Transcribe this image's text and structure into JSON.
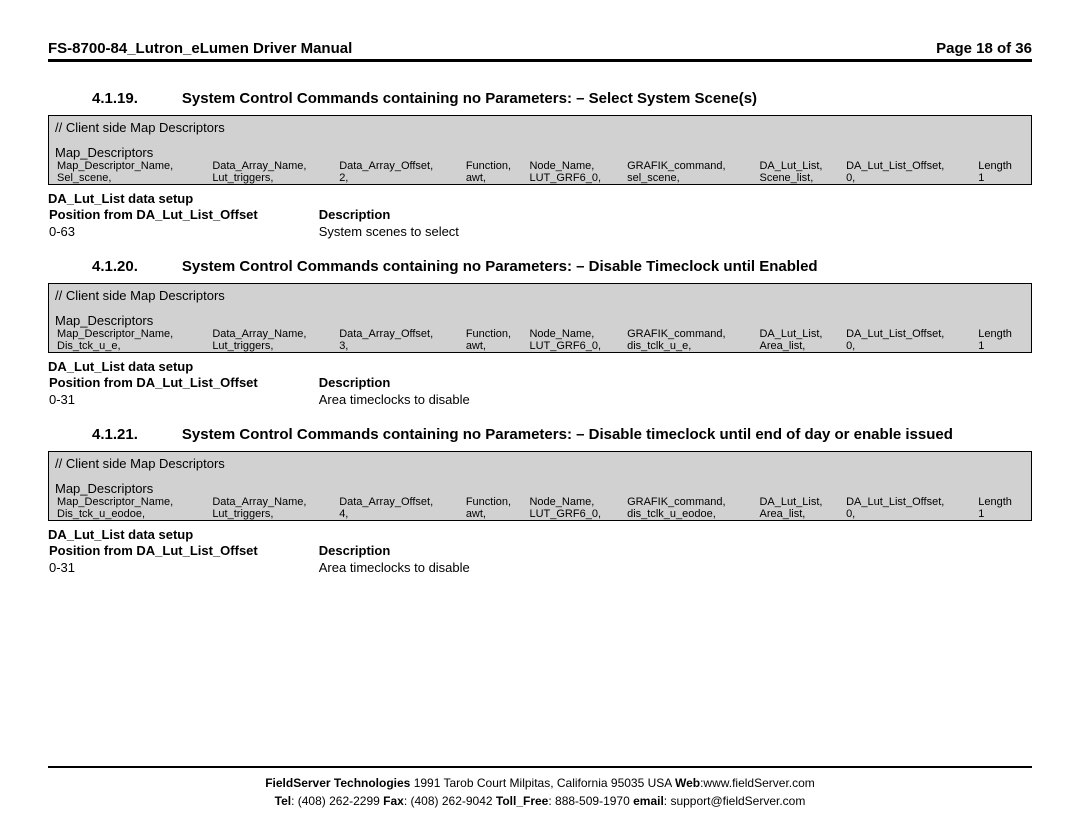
{
  "header": {
    "title": "FS-8700-84_Lutron_eLumen Driver Manual",
    "page": "Page 18 of 36"
  },
  "csv_columns": [
    "Map_Descriptor_Name,",
    "Data_Array_Name,",
    "Data_Array_Offset,",
    "Function,",
    "Node_Name,",
    "GRAFIK_command,",
    "DA_Lut_List,",
    "DA_Lut_List_Offset,",
    "Length"
  ],
  "common": {
    "comment": "//    Client side Map Descriptors",
    "mapdesc": "Map_Descriptors",
    "setup_head": "DA_Lut_List data setup",
    "pos_head": "Position from DA_Lut_List_Offset",
    "desc_head": "Description"
  },
  "sections": [
    {
      "num": "4.1.19.",
      "title": "System Control Commands containing no Parameters: – Select System Scene(s)",
      "row": [
        "Sel_scene,",
        "Lut_triggers,",
        "2,",
        "awt,",
        "LUT_GRF6_0,",
        "sel_scene,",
        "Scene_list,",
        "0,",
        "1"
      ],
      "pos": "0-63",
      "desc": "System scenes to select"
    },
    {
      "num": "4.1.20.",
      "title": "System Control Commands containing no Parameters: – Disable Timeclock until Enabled",
      "row": [
        "Dis_tck_u_e,",
        "Lut_triggers,",
        "3,",
        "awt,",
        "LUT_GRF6_0,",
        "dis_tclk_u_e,",
        "Area_list,",
        "0,",
        "1"
      ],
      "pos": "0-31",
      "desc": "Area timeclocks to disable"
    },
    {
      "num": "4.1.21.",
      "title": "System Control Commands containing no Parameters: – Disable timeclock until end of day or enable issued",
      "title_wrapped": true,
      "row": [
        "Dis_tck_u_eodoe,",
        "Lut_triggers,",
        "4,",
        "awt,",
        "LUT_GRF6_0,",
        "dis_tclk_u_eodoe,",
        "Area_list,",
        "0,",
        "1"
      ],
      "pos": "0-31",
      "desc": "Area timeclocks to disable"
    }
  ],
  "footer": {
    "line1a": "FieldServer Technologies",
    "line1b": " 1991 Tarob Court Milpitas, California 95035 USA  ",
    "web_l": "Web",
    "web_v": ":www.fieldServer.com",
    "tel_l": "Tel",
    "tel_v": ": (408) 262-2299  ",
    "fax_l": "Fax",
    "fax_v": ": (408) 262-9042  ",
    "toll_l": "Toll_Free",
    "toll_v": ": 888-509-1970  ",
    "email_l": "email",
    "email_v": ": support@fieldServer.com"
  }
}
